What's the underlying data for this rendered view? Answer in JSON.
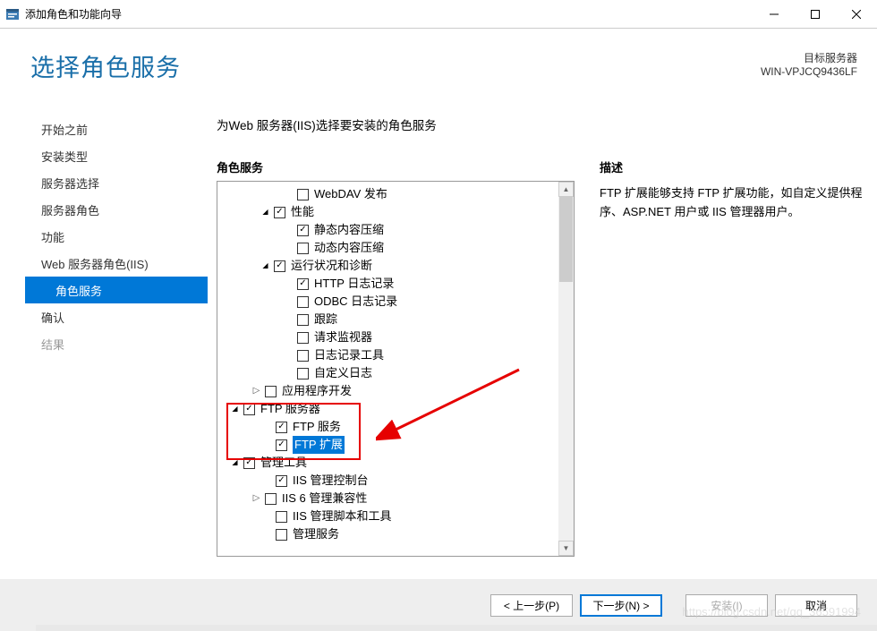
{
  "window": {
    "title": "添加角色和功能向导"
  },
  "header": {
    "page_title": "选择角色服务",
    "target_server_label": "目标服务器",
    "server_name": "WIN-VPJCQ9436LF"
  },
  "sidebar": {
    "items": [
      {
        "label": "开始之前",
        "selected": false,
        "disabled": false,
        "indent": false
      },
      {
        "label": "安装类型",
        "selected": false,
        "disabled": false,
        "indent": false
      },
      {
        "label": "服务器选择",
        "selected": false,
        "disabled": false,
        "indent": false
      },
      {
        "label": "服务器角色",
        "selected": false,
        "disabled": false,
        "indent": false
      },
      {
        "label": "功能",
        "selected": false,
        "disabled": false,
        "indent": false
      },
      {
        "label": "Web 服务器角色(IIS)",
        "selected": false,
        "disabled": false,
        "indent": false
      },
      {
        "label": "角色服务",
        "selected": true,
        "disabled": false,
        "indent": true
      },
      {
        "label": "确认",
        "selected": false,
        "disabled": false,
        "indent": false
      },
      {
        "label": "结果",
        "selected": false,
        "disabled": true,
        "indent": false
      }
    ]
  },
  "main": {
    "instruction": "为Web 服务器(IIS)选择要安装的角色服务",
    "tree_header": "角色服务",
    "desc_header": "描述",
    "description": "FTP 扩展能够支持 FTP 扩展功能，如自定义提供程序、ASP.NET 用户或 IIS 管理器用户。",
    "tree": [
      {
        "indent": 72,
        "expander": "",
        "checked": false,
        "label": "WebDAV 发布"
      },
      {
        "indent": 46,
        "expander": "▾",
        "checked": true,
        "label": "性能"
      },
      {
        "indent": 72,
        "expander": "",
        "checked": true,
        "label": "静态内容压缩"
      },
      {
        "indent": 72,
        "expander": "",
        "checked": false,
        "label": "动态内容压缩"
      },
      {
        "indent": 46,
        "expander": "▾",
        "checked": true,
        "label": "运行状况和诊断"
      },
      {
        "indent": 72,
        "expander": "",
        "checked": true,
        "label": "HTTP 日志记录"
      },
      {
        "indent": 72,
        "expander": "",
        "checked": false,
        "label": "ODBC 日志记录"
      },
      {
        "indent": 72,
        "expander": "",
        "checked": false,
        "label": "跟踪"
      },
      {
        "indent": 72,
        "expander": "",
        "checked": false,
        "label": "请求监视器"
      },
      {
        "indent": 72,
        "expander": "",
        "checked": false,
        "label": "日志记录工具"
      },
      {
        "indent": 72,
        "expander": "",
        "checked": false,
        "label": "自定义日志"
      },
      {
        "indent": 36,
        "expander": "▸",
        "checked": false,
        "label": "应用程序开发"
      },
      {
        "indent": 12,
        "expander": "▾",
        "checked": true,
        "label": "FTP 服务器"
      },
      {
        "indent": 48,
        "expander": "",
        "checked": true,
        "label": "FTP 服务"
      },
      {
        "indent": 48,
        "expander": "",
        "checked": true,
        "label": "FTP 扩展",
        "selected": true
      },
      {
        "indent": 12,
        "expander": "▾",
        "checked": true,
        "label": "管理工具"
      },
      {
        "indent": 48,
        "expander": "",
        "checked": true,
        "label": "IIS 管理控制台"
      },
      {
        "indent": 36,
        "expander": "▸",
        "checked": false,
        "label": "IIS 6 管理兼容性"
      },
      {
        "indent": 48,
        "expander": "",
        "checked": false,
        "label": "IIS 管理脚本和工具"
      },
      {
        "indent": 48,
        "expander": "",
        "checked": false,
        "label": "管理服务"
      }
    ]
  },
  "buttons": {
    "prev": "< 上一步(P)",
    "next": "下一步(N) >",
    "install": "安装(I)",
    "cancel": "取消"
  },
  "watermark": "https://blog.csdn.net/qq_36591994"
}
